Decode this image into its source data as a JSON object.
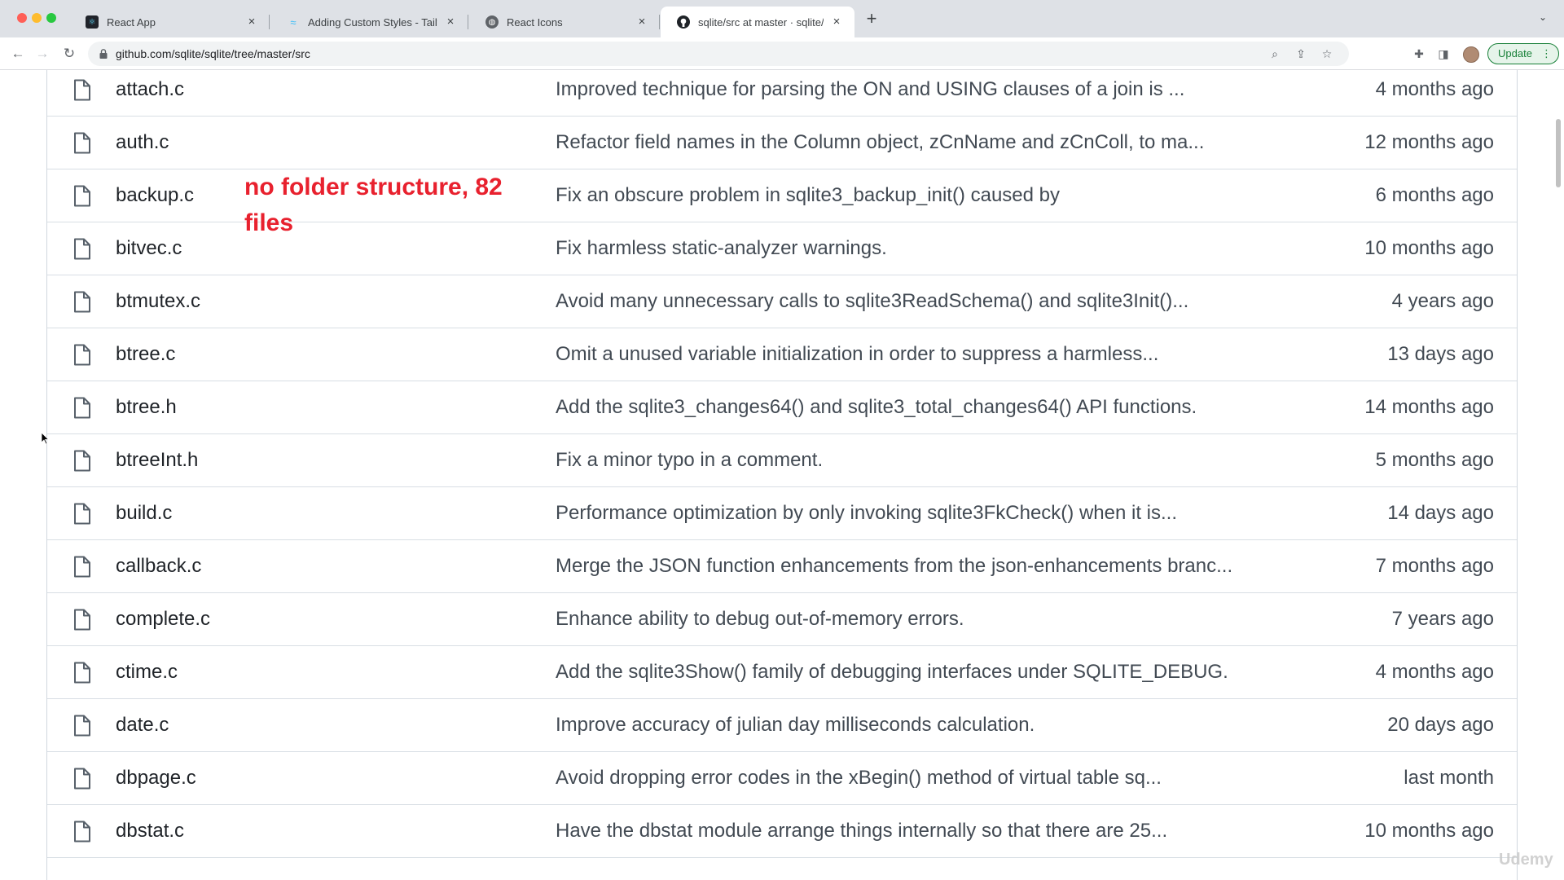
{
  "browser": {
    "tabs": [
      {
        "title": "React App",
        "favicon": "react-app-icon"
      },
      {
        "title": "Adding Custom Styles - Tailwind",
        "favicon": "tailwind-icon"
      },
      {
        "title": "React Icons",
        "favicon": "globe-icon"
      },
      {
        "title": "sqlite/src at master · sqlite/sqlite",
        "favicon": "github-icon",
        "active": true
      }
    ],
    "url": "github.com/sqlite/sqlite/tree/master/src",
    "update_label": "Update"
  },
  "annotation": "no folder structure, 82 files",
  "watermark": "Udemy",
  "files": [
    {
      "name": "attach.c",
      "message": "Improved technique for parsing the ON and USING clauses of a join is ...",
      "age": "4 months ago"
    },
    {
      "name": "auth.c",
      "message": "Refactor field names in the Column object, zCnName and zCnColl, to ma...",
      "age": "12 months ago"
    },
    {
      "name": "backup.c",
      "message": "Fix an obscure problem in sqlite3_backup_init() caused by",
      "age": "6 months ago"
    },
    {
      "name": "bitvec.c",
      "message": "Fix harmless static-analyzer warnings.",
      "age": "10 months ago"
    },
    {
      "name": "btmutex.c",
      "message": "Avoid many unnecessary calls to sqlite3ReadSchema() and sqlite3Init()...",
      "age": "4 years ago"
    },
    {
      "name": "btree.c",
      "message": "Omit a unused variable initialization in order to suppress a harmless...",
      "age": "13 days ago"
    },
    {
      "name": "btree.h",
      "message": "Add the sqlite3_changes64() and sqlite3_total_changes64() API functions.",
      "age": "14 months ago"
    },
    {
      "name": "btreeInt.h",
      "message": "Fix a minor typo in a comment.",
      "age": "5 months ago"
    },
    {
      "name": "build.c",
      "message": "Performance optimization by only invoking sqlite3FkCheck() when it is...",
      "age": "14 days ago"
    },
    {
      "name": "callback.c",
      "message": "Merge the JSON function enhancements from the json-enhancements branc...",
      "age": "7 months ago"
    },
    {
      "name": "complete.c",
      "message": "Enhance ability to debug out-of-memory errors.",
      "age": "7 years ago"
    },
    {
      "name": "ctime.c",
      "message": "Add the sqlite3Show() family of debugging interfaces under SQLITE_DEBUG.",
      "age": "4 months ago"
    },
    {
      "name": "date.c",
      "message": "Improve accuracy of julian day milliseconds calculation.",
      "age": "20 days ago"
    },
    {
      "name": "dbpage.c",
      "message": "Avoid dropping error codes in the xBegin() method of virtual table sq...",
      "age": "last month"
    },
    {
      "name": "dbstat.c",
      "message": "Have the dbstat module arrange things internally so that there are 25...",
      "age": "10 months ago"
    }
  ]
}
